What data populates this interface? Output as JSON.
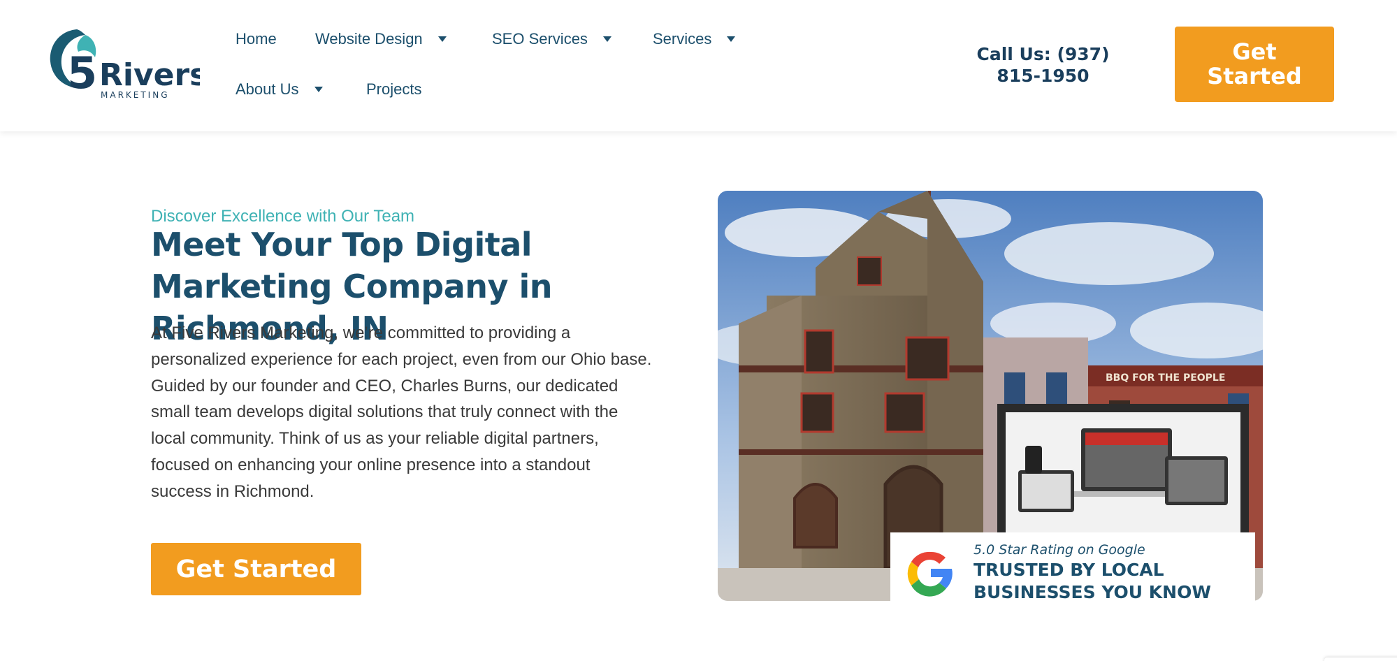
{
  "header": {
    "logo": {
      "numeral": "5",
      "word": "Rivers",
      "sub": "MARKETING"
    },
    "nav": [
      {
        "label": "Home",
        "has_dropdown": false
      },
      {
        "label": "Website Design",
        "has_dropdown": true
      },
      {
        "label": "SEO Services",
        "has_dropdown": true
      },
      {
        "label": "Services",
        "has_dropdown": true
      },
      {
        "label": "About Us",
        "has_dropdown": true
      },
      {
        "label": "Projects",
        "has_dropdown": false
      }
    ],
    "call_prefix": "Call Us:",
    "phone_area": "(937)",
    "phone_number": "815-1950",
    "cta_line1": "Get",
    "cta_line2": "Started"
  },
  "hero": {
    "eyebrow": "Discover Excellence with Our Team",
    "title": "Meet Your Top Digital Marketing Company in Richmond, IN",
    "body_lines": [
      "At Five Rivers Marketing, we’re committed to providing a",
      "personalized experience for each project, even from our Ohio base.",
      "Guided by our founder and CEO, Charles Burns, our dedicated",
      "small team develops digital solutions that truly connect with the",
      "local community. Think of us as your reliable digital partners,",
      "focused on enhancing your online presence into a standout",
      "success in Richmond."
    ],
    "cta": "Get Started"
  },
  "image": {
    "storefront_sign": "BBQ FOR THE PEOPLE",
    "badge_rating": "5.0 Star Rating on Google",
    "badge_line1": "TRUSTED BY LOCAL",
    "badge_line2": "BUSINESSES YOU KNOW"
  },
  "colors": {
    "brand_navy": "#1c4f6c",
    "accent_orange": "#f29c1f",
    "teal": "#3fb2b4"
  }
}
